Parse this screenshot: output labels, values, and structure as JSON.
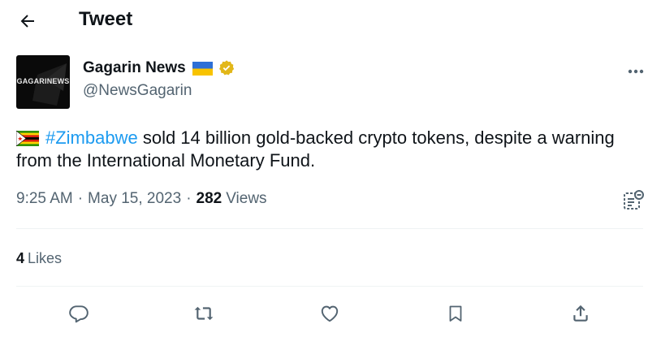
{
  "header": {
    "title": "Tweet",
    "back_icon": "arrow-left-icon"
  },
  "author": {
    "avatar_text": "GAGARINEWS",
    "name": "Gagarin News",
    "handle": "@NewsGagarin",
    "flag_icon": "ukraine-flag-icon",
    "verified_icon": "gold-verified-badge-icon"
  },
  "tweet": {
    "flag_icon": "zimbabwe-flag-icon",
    "hashtag": "#Zimbabwe",
    "text": " sold 14 billion gold-backed crypto tokens, despite a warning from the International Monetary Fund."
  },
  "meta": {
    "time": "9:25 AM",
    "separator": "·",
    "date": "May 15, 2023",
    "views_count": "282",
    "views_label": "Views"
  },
  "likes": {
    "count": "4",
    "label": "Likes"
  },
  "colors": {
    "link": "#1d9bf0",
    "secondary_text": "#536471",
    "primary_text": "#0f1419",
    "verified_gold": "#e2b719"
  },
  "actions": [
    "reply-icon",
    "retweet-icon",
    "like-icon",
    "bookmark-icon",
    "share-icon"
  ]
}
